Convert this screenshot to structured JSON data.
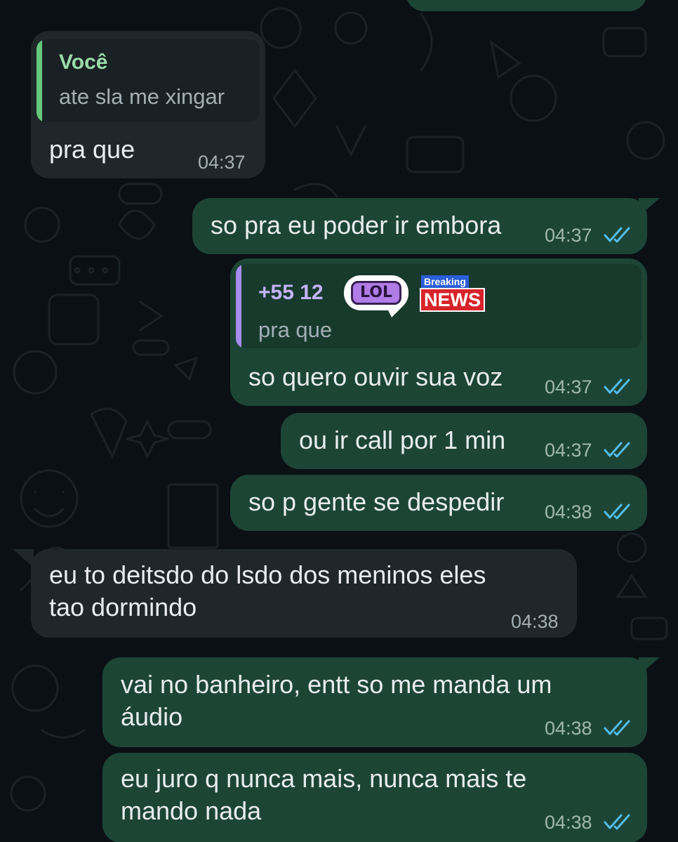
{
  "colors": {
    "background": "#0b1014",
    "incoming_bubble": "#1f272a",
    "outgoing_bubble": "#1d4536",
    "own_quote_accent": "#64c87a",
    "contact_quote_accent": "#a78cf0",
    "read_ticks": "#53bdeb"
  },
  "icons": {
    "read_receipt": "double-check-icon"
  },
  "stickers": {
    "lol": "LOL",
    "breaking": "Breaking",
    "news": "NEWS"
  },
  "messages": [
    {
      "direction": "incoming",
      "quote": {
        "author": "Você",
        "text": "ate sla me xingar"
      },
      "text": "pra que",
      "time": "04:37"
    },
    {
      "direction": "outgoing",
      "text": "so pra eu poder ir embora",
      "time": "04:37",
      "status": "read"
    },
    {
      "direction": "outgoing",
      "quote": {
        "author": "+55 12",
        "text": "pra que"
      },
      "text": "so quero ouvir sua voz",
      "time": "04:37",
      "status": "read"
    },
    {
      "direction": "outgoing",
      "text": "ou ir call por 1 min",
      "time": "04:37",
      "status": "read"
    },
    {
      "direction": "outgoing",
      "text": "so p gente se despedir",
      "time": "04:38",
      "status": "read"
    },
    {
      "direction": "incoming",
      "text": "eu to deitsdo do lsdo dos meninos eles\ntao dormindo",
      "time": "04:38"
    },
    {
      "direction": "outgoing",
      "text": "vai no banheiro, entt so me manda um\náudio",
      "time": "04:38",
      "status": "read"
    },
    {
      "direction": "outgoing",
      "text": "eu juro q nunca mais, nunca mais te\nmando nada",
      "time": "04:38",
      "status": "read"
    }
  ]
}
